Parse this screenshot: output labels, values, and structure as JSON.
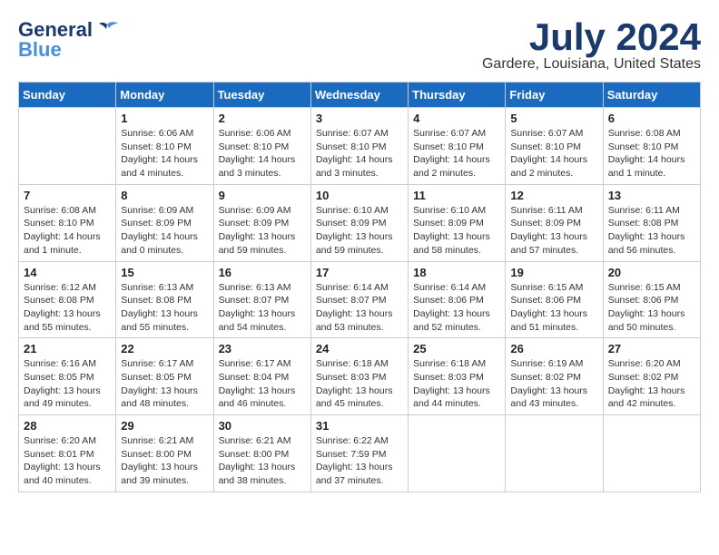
{
  "logo": {
    "line1": "General",
    "line2": "Blue"
  },
  "title": "July 2024",
  "subtitle": "Gardere, Louisiana, United States",
  "days_of_week": [
    "Sunday",
    "Monday",
    "Tuesday",
    "Wednesday",
    "Thursday",
    "Friday",
    "Saturday"
  ],
  "weeks": [
    [
      {
        "day": "",
        "sunrise": "",
        "sunset": "",
        "daylight": ""
      },
      {
        "day": "1",
        "sunrise": "Sunrise: 6:06 AM",
        "sunset": "Sunset: 8:10 PM",
        "daylight": "Daylight: 14 hours and 4 minutes."
      },
      {
        "day": "2",
        "sunrise": "Sunrise: 6:06 AM",
        "sunset": "Sunset: 8:10 PM",
        "daylight": "Daylight: 14 hours and 3 minutes."
      },
      {
        "day": "3",
        "sunrise": "Sunrise: 6:07 AM",
        "sunset": "Sunset: 8:10 PM",
        "daylight": "Daylight: 14 hours and 3 minutes."
      },
      {
        "day": "4",
        "sunrise": "Sunrise: 6:07 AM",
        "sunset": "Sunset: 8:10 PM",
        "daylight": "Daylight: 14 hours and 2 minutes."
      },
      {
        "day": "5",
        "sunrise": "Sunrise: 6:07 AM",
        "sunset": "Sunset: 8:10 PM",
        "daylight": "Daylight: 14 hours and 2 minutes."
      },
      {
        "day": "6",
        "sunrise": "Sunrise: 6:08 AM",
        "sunset": "Sunset: 8:10 PM",
        "daylight": "Daylight: 14 hours and 1 minute."
      }
    ],
    [
      {
        "day": "7",
        "sunrise": "Sunrise: 6:08 AM",
        "sunset": "Sunset: 8:10 PM",
        "daylight": "Daylight: 14 hours and 1 minute."
      },
      {
        "day": "8",
        "sunrise": "Sunrise: 6:09 AM",
        "sunset": "Sunset: 8:09 PM",
        "daylight": "Daylight: 14 hours and 0 minutes."
      },
      {
        "day": "9",
        "sunrise": "Sunrise: 6:09 AM",
        "sunset": "Sunset: 8:09 PM",
        "daylight": "Daylight: 13 hours and 59 minutes."
      },
      {
        "day": "10",
        "sunrise": "Sunrise: 6:10 AM",
        "sunset": "Sunset: 8:09 PM",
        "daylight": "Daylight: 13 hours and 59 minutes."
      },
      {
        "day": "11",
        "sunrise": "Sunrise: 6:10 AM",
        "sunset": "Sunset: 8:09 PM",
        "daylight": "Daylight: 13 hours and 58 minutes."
      },
      {
        "day": "12",
        "sunrise": "Sunrise: 6:11 AM",
        "sunset": "Sunset: 8:09 PM",
        "daylight": "Daylight: 13 hours and 57 minutes."
      },
      {
        "day": "13",
        "sunrise": "Sunrise: 6:11 AM",
        "sunset": "Sunset: 8:08 PM",
        "daylight": "Daylight: 13 hours and 56 minutes."
      }
    ],
    [
      {
        "day": "14",
        "sunrise": "Sunrise: 6:12 AM",
        "sunset": "Sunset: 8:08 PM",
        "daylight": "Daylight: 13 hours and 55 minutes."
      },
      {
        "day": "15",
        "sunrise": "Sunrise: 6:13 AM",
        "sunset": "Sunset: 8:08 PM",
        "daylight": "Daylight: 13 hours and 55 minutes."
      },
      {
        "day": "16",
        "sunrise": "Sunrise: 6:13 AM",
        "sunset": "Sunset: 8:07 PM",
        "daylight": "Daylight: 13 hours and 54 minutes."
      },
      {
        "day": "17",
        "sunrise": "Sunrise: 6:14 AM",
        "sunset": "Sunset: 8:07 PM",
        "daylight": "Daylight: 13 hours and 53 minutes."
      },
      {
        "day": "18",
        "sunrise": "Sunrise: 6:14 AM",
        "sunset": "Sunset: 8:06 PM",
        "daylight": "Daylight: 13 hours and 52 minutes."
      },
      {
        "day": "19",
        "sunrise": "Sunrise: 6:15 AM",
        "sunset": "Sunset: 8:06 PM",
        "daylight": "Daylight: 13 hours and 51 minutes."
      },
      {
        "day": "20",
        "sunrise": "Sunrise: 6:15 AM",
        "sunset": "Sunset: 8:06 PM",
        "daylight": "Daylight: 13 hours and 50 minutes."
      }
    ],
    [
      {
        "day": "21",
        "sunrise": "Sunrise: 6:16 AM",
        "sunset": "Sunset: 8:05 PM",
        "daylight": "Daylight: 13 hours and 49 minutes."
      },
      {
        "day": "22",
        "sunrise": "Sunrise: 6:17 AM",
        "sunset": "Sunset: 8:05 PM",
        "daylight": "Daylight: 13 hours and 48 minutes."
      },
      {
        "day": "23",
        "sunrise": "Sunrise: 6:17 AM",
        "sunset": "Sunset: 8:04 PM",
        "daylight": "Daylight: 13 hours and 46 minutes."
      },
      {
        "day": "24",
        "sunrise": "Sunrise: 6:18 AM",
        "sunset": "Sunset: 8:03 PM",
        "daylight": "Daylight: 13 hours and 45 minutes."
      },
      {
        "day": "25",
        "sunrise": "Sunrise: 6:18 AM",
        "sunset": "Sunset: 8:03 PM",
        "daylight": "Daylight: 13 hours and 44 minutes."
      },
      {
        "day": "26",
        "sunrise": "Sunrise: 6:19 AM",
        "sunset": "Sunset: 8:02 PM",
        "daylight": "Daylight: 13 hours and 43 minutes."
      },
      {
        "day": "27",
        "sunrise": "Sunrise: 6:20 AM",
        "sunset": "Sunset: 8:02 PM",
        "daylight": "Daylight: 13 hours and 42 minutes."
      }
    ],
    [
      {
        "day": "28",
        "sunrise": "Sunrise: 6:20 AM",
        "sunset": "Sunset: 8:01 PM",
        "daylight": "Daylight: 13 hours and 40 minutes."
      },
      {
        "day": "29",
        "sunrise": "Sunrise: 6:21 AM",
        "sunset": "Sunset: 8:00 PM",
        "daylight": "Daylight: 13 hours and 39 minutes."
      },
      {
        "day": "30",
        "sunrise": "Sunrise: 6:21 AM",
        "sunset": "Sunset: 8:00 PM",
        "daylight": "Daylight: 13 hours and 38 minutes."
      },
      {
        "day": "31",
        "sunrise": "Sunrise: 6:22 AM",
        "sunset": "Sunset: 7:59 PM",
        "daylight": "Daylight: 13 hours and 37 minutes."
      },
      {
        "day": "",
        "sunrise": "",
        "sunset": "",
        "daylight": ""
      },
      {
        "day": "",
        "sunrise": "",
        "sunset": "",
        "daylight": ""
      },
      {
        "day": "",
        "sunrise": "",
        "sunset": "",
        "daylight": ""
      }
    ]
  ]
}
